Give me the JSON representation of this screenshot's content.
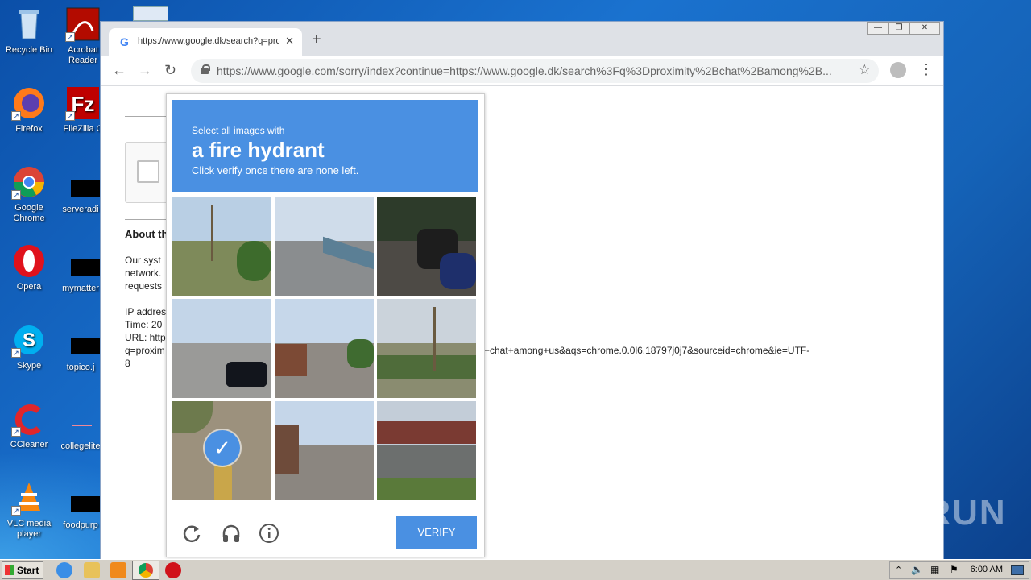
{
  "desktop": {
    "icons": [
      {
        "label": "Recycle Bin",
        "icon": "recycle-bin-icon"
      },
      {
        "label": "Acrobat Reader",
        "icon": "acrobat-icon"
      },
      {
        "label": "Firefox",
        "icon": "firefox-icon"
      },
      {
        "label": "FileZilla C",
        "icon": "filezilla-icon"
      },
      {
        "label": "Google Chrome",
        "icon": "chrome-icon"
      },
      {
        "label": "serveradi",
        "icon": "blackbar-icon"
      },
      {
        "label": "Opera",
        "icon": "opera-icon"
      },
      {
        "label": "mymatter",
        "icon": "blackbar-icon"
      },
      {
        "label": "Skype",
        "icon": "skype-icon"
      },
      {
        "label": "topico.j",
        "icon": "blackbar-icon"
      },
      {
        "label": "CCleaner",
        "icon": "ccleaner-icon"
      },
      {
        "label": "collegelite",
        "icon": "doc-icon"
      },
      {
        "label": "VLC media player",
        "icon": "vlc-icon"
      },
      {
        "label": "foodpurp",
        "icon": "blackbar-icon"
      }
    ]
  },
  "browser": {
    "tab_title": "https://www.google.dk/search?q=proximity+chat+among+us",
    "new_tab": "+",
    "url": "https://www.google.com/sorry/index?continue=https://www.google.dk/search%3Fq%3Dproximity%2Bchat%2Bamong%2B..."
  },
  "page": {
    "about_heading": "About th",
    "line1": "Our syst",
    "line2": "network.",
    "line3": "requests",
    "line4": "IP addres",
    "line5": "Time: 20",
    "line6": "URL: http",
    "line7": "q=proxim",
    "line8": "8",
    "url_tail": "+chat+among+us&aqs=chrome.0.0l6.18797j0j7&sourceid=chrome&ie=UTF-"
  },
  "captcha": {
    "select_line": "Select all images with",
    "target": "a fire hydrant",
    "instruction": "Click verify once there are none left.",
    "verify_label": "VERIFY",
    "selected_tile": 7
  },
  "watermark": "ANY RUN",
  "taskbar": {
    "start_label": "Start",
    "clock": "6:00 AM"
  },
  "colors": {
    "captcha_blue": "#4a90e2",
    "desktop_blue": "#1a72cf"
  }
}
